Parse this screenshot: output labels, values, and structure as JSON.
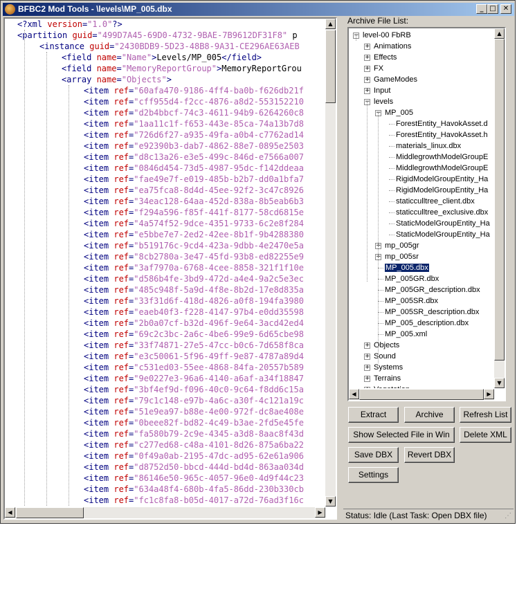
{
  "window": {
    "title": "BFBC2 Mod Tools - \\levels\\MP_005.dbx"
  },
  "editor": {
    "header_lines": [
      [
        [
          "t-tag",
          "<?xml "
        ],
        [
          "t-attr",
          "version"
        ],
        [
          "t-tag",
          "="
        ],
        [
          "t-val",
          "\"1.0\""
        ],
        [
          "t-tag",
          "?>"
        ]
      ],
      [
        [
          "t-tag",
          "<partition "
        ],
        [
          "t-attr",
          "guid"
        ],
        [
          "t-tag",
          "="
        ],
        [
          "t-val",
          "\"499D7A45-69D0-4732-9BAE-7B9612DF31F8\""
        ],
        [
          "t-plain",
          " p"
        ]
      ],
      [
        [
          "t-tag",
          "<instance "
        ],
        [
          "t-attr",
          "guid"
        ],
        [
          "t-tag",
          "="
        ],
        [
          "t-val",
          "\"2430BDB9-5D23-48B8-9A31-CE296AE63AEB"
        ]
      ],
      [
        [
          "t-tag",
          "<field "
        ],
        [
          "t-attr",
          "name"
        ],
        [
          "t-tag",
          "="
        ],
        [
          "t-val",
          "\"Name\""
        ],
        [
          "t-tag",
          ">"
        ],
        [
          "t-plain",
          "Levels/MP_005"
        ],
        [
          "t-tag",
          "</field>"
        ]
      ],
      [
        [
          "t-tag",
          "<field "
        ],
        [
          "t-attr",
          "name"
        ],
        [
          "t-tag",
          "="
        ],
        [
          "t-val",
          "\"MemoryReportGroup\""
        ],
        [
          "t-tag",
          ">"
        ],
        [
          "t-plain",
          "MemoryReportGrou"
        ]
      ],
      [
        [
          "t-tag",
          "<array "
        ],
        [
          "t-attr",
          "name"
        ],
        [
          "t-tag",
          "="
        ],
        [
          "t-val",
          "\"Objects\""
        ],
        [
          "t-tag",
          ">"
        ]
      ]
    ],
    "item_refs": [
      "\"60afa470-9186-4ff4-ba0b-f626db21f",
      "\"cff955d4-f2cc-4876-a8d2-553152210",
      "\"d2b4bbcf-74c3-4611-94b9-6264260c8",
      "\"1aa11c1f-f653-443e-85ca-74a13b7d8",
      "\"726d6f27-a935-49fa-a0b4-c7762ad14",
      "\"e92390b3-dab7-4862-88e7-0895e2503",
      "\"d8c13a26-e3e5-499c-846d-e7566a007",
      "\"0846d454-73d5-4987-95dc-f142ddeaa",
      "\"fae49e7f-e019-485b-b2b7-dd0a1bfa7",
      "\"ea75fca8-8d4d-45ee-92f2-3c47c8926",
      "\"34eac128-64aa-452d-838a-8b5eab6b3",
      "\"f294a596-f85f-441f-8177-58cd6815e",
      "\"4a574f52-9dce-4351-9733-6c2e8f284",
      "\"e5bbe7e7-2ed2-42ee-8b1f-9b4288380",
      "\"b519176c-9cd4-423a-9dbb-4e2470e5a",
      "\"8cb2780a-3e47-45fd-93b8-ed82255e9",
      "\"3af7970a-6768-4cee-8858-321f1f10e",
      "\"d586b4fe-3bd9-472d-a4e4-9a2c5e3ec",
      "\"485c948f-5a9d-4f8e-8b2d-17e8d835a",
      "\"33f31d6f-418d-4826-a0f8-194fa3980",
      "\"eaeb40f3-f228-4147-97b4-e0dd35598",
      "\"2b0a07cf-b32d-496f-9e64-3acd42ed4",
      "\"69c2c3bc-2a6c-4be6-99e9-6d65cbe98",
      "\"33f74871-27e5-47cc-b0c6-7d658f8ca",
      "\"e3c50061-5f96-49ff-9e87-4787a89d4",
      "\"c531ed03-55ee-4868-84fa-20557b589",
      "\"9e0227e3-96a6-4140-a6af-a34f18847",
      "\"3bf4ef9d-f096-40c0-9c64-f8dd6c15a",
      "\"79c1c148-e97b-4a6c-a30f-4c121a19c",
      "\"51e9ea97-b88e-4e00-972f-dc8ae408e",
      "\"0beee82f-bd82-4c49-b3ae-2fd5e45fe",
      "\"fa580b79-2c9e-4345-a3d8-8aac8f43d",
      "\"c277ed68-c48a-4101-8d26-875a6ba22",
      "\"0f49a0ab-2195-47dc-ad95-62e61a906",
      "\"d8752d50-bbcd-444d-bd4d-863aa034d",
      "\"86146e50-965c-4057-96e0-4d9f44c23",
      "\"634a48f4-680b-4fa5-86dd-230b330cb",
      "\"fc1c8fa8-b05d-4017-a72d-76ad3f16c"
    ],
    "item_tag": "<item ",
    "item_attr": "ref",
    "item_eq": "="
  },
  "archive": {
    "label": "Archive File List:",
    "tree": [
      {
        "level": 0,
        "exp": "-",
        "text": "level-00 FbRB"
      },
      {
        "level": 1,
        "exp": "+",
        "text": "Animations"
      },
      {
        "level": 1,
        "exp": "+",
        "text": "Effects"
      },
      {
        "level": 1,
        "exp": "+",
        "text": "FX"
      },
      {
        "level": 1,
        "exp": "+",
        "text": "GameModes"
      },
      {
        "level": 1,
        "exp": "+",
        "text": "Input"
      },
      {
        "level": 1,
        "exp": "-",
        "text": "levels"
      },
      {
        "level": 2,
        "exp": "-",
        "text": "MP_005"
      },
      {
        "level": 3,
        "exp": "",
        "text": "ForestEntity_HavokAsset.d"
      },
      {
        "level": 3,
        "exp": "",
        "text": "ForestEntity_HavokAsset.h"
      },
      {
        "level": 3,
        "exp": "",
        "text": "materials_linux.dbx"
      },
      {
        "level": 3,
        "exp": "",
        "text": "MiddlegrowthModelGroupE"
      },
      {
        "level": 3,
        "exp": "",
        "text": "MiddlegrowthModelGroupE"
      },
      {
        "level": 3,
        "exp": "",
        "text": "RigidModelGroupEntity_Ha"
      },
      {
        "level": 3,
        "exp": "",
        "text": "RigidModelGroupEntity_Ha"
      },
      {
        "level": 3,
        "exp": "",
        "text": "staticculltree_client.dbx"
      },
      {
        "level": 3,
        "exp": "",
        "text": "staticculltree_exclusive.dbx"
      },
      {
        "level": 3,
        "exp": "",
        "text": "StaticModelGroupEntity_Ha"
      },
      {
        "level": 3,
        "exp": "",
        "text": "StaticModelGroupEntity_Ha"
      },
      {
        "level": 2,
        "exp": "+",
        "text": "mp_005gr"
      },
      {
        "level": 2,
        "exp": "+",
        "text": "mp_005sr"
      },
      {
        "level": 2,
        "exp": "",
        "text": "MP_005.dbx",
        "selected": true
      },
      {
        "level": 2,
        "exp": "",
        "text": "MP_005GR.dbx"
      },
      {
        "level": 2,
        "exp": "",
        "text": "MP_005GR_description.dbx"
      },
      {
        "level": 2,
        "exp": "",
        "text": "MP_005SR.dbx"
      },
      {
        "level": 2,
        "exp": "",
        "text": "MP_005SR_description.dbx"
      },
      {
        "level": 2,
        "exp": "",
        "text": "MP_005_description.dbx"
      },
      {
        "level": 2,
        "exp": "",
        "text": "MP_005.xml"
      },
      {
        "level": 1,
        "exp": "+",
        "text": "Objects"
      },
      {
        "level": 1,
        "exp": "+",
        "text": "Sound"
      },
      {
        "level": 1,
        "exp": "+",
        "text": "Systems"
      },
      {
        "level": 1,
        "exp": "+",
        "text": "Terrains"
      },
      {
        "level": 1,
        "exp": "+",
        "text": "Vegetation"
      }
    ]
  },
  "buttons": {
    "extract": "Extract",
    "archive": "Archive",
    "refresh_list": "Refresh List",
    "show_selected": "Show Selected File in Win",
    "delete_xml": "Delete XML",
    "save_dbx": "Save DBX",
    "revert_dbx": "Revert DBX",
    "settings": "Settings"
  },
  "status": {
    "text": "Status: Idle (Last Task: Open DBX file)"
  }
}
